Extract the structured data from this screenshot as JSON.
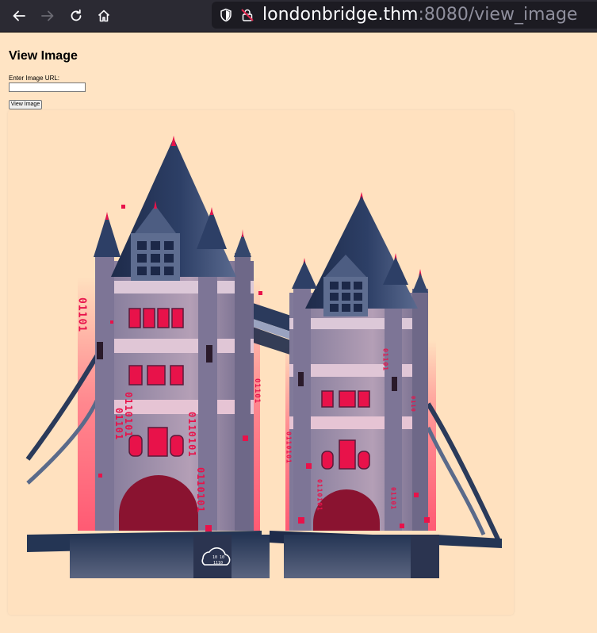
{
  "browser": {
    "url_host": "londonbridge.thm",
    "url_rest": ":8080/view_image",
    "icons": [
      "back-arrow-icon",
      "forward-arrow-icon",
      "reload-icon",
      "home-icon",
      "shield-icon",
      "lock-icon"
    ]
  },
  "page": {
    "title": "View Image",
    "input_label": "Enter Image URL:",
    "input_value": "",
    "button_label": "View Image"
  },
  "image": {
    "description_icon": "cloud-binary-logo",
    "logo_digits_top": "10 10",
    "logo_digits_mid": "1110",
    "binary_strings": [
      "01101",
      "0110101",
      "01101",
      "0110101",
      "0110101",
      "01101",
      "0110101",
      "0110101",
      "01101",
      "01101",
      "0110"
    ]
  },
  "colors": {
    "page_bg": "#ffe4c4",
    "toolbar_bg": "#2b2a33",
    "accent_red": "#e8124a",
    "tower_navy": "#243554"
  }
}
